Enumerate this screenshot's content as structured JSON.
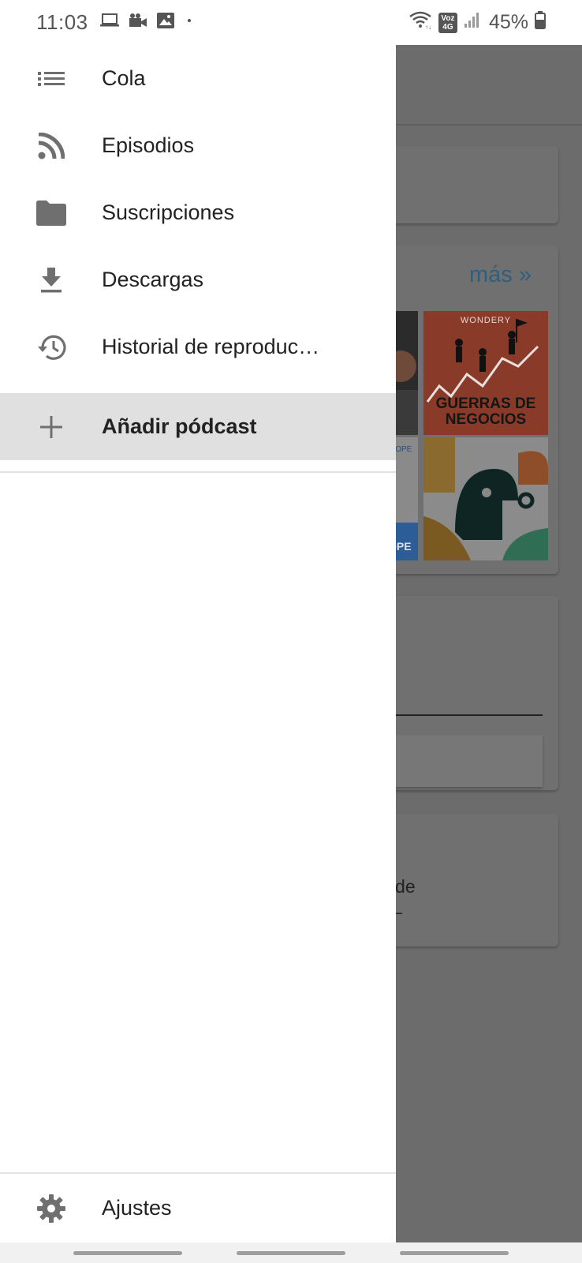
{
  "status_bar": {
    "time": "11:03",
    "battery_percent": "45%",
    "network_badge_top": "Voz",
    "network_badge_bottom": "4G",
    "left_icons": [
      "laptop-icon",
      "video-camera-icon",
      "image-icon",
      "dot-icon"
    ],
    "right_icons": [
      "wifi-icon",
      "network-badge-icon",
      "signal-icon",
      "battery-icon"
    ]
  },
  "drawer": {
    "items": [
      {
        "label": "Cola",
        "icon": "queue-list-icon"
      },
      {
        "label": "Episodios",
        "icon": "rss-feed-icon"
      },
      {
        "label": "Suscripciones",
        "icon": "folder-icon"
      },
      {
        "label": "Descargas",
        "icon": "download-icon"
      },
      {
        "label": "Historial de reproduc…",
        "icon": "history-icon"
      },
      {
        "label": "Añadir pódcast",
        "icon": "plus-icon",
        "active": true
      }
    ],
    "settings_label": "Ajustes",
    "settings_icon": "gear-icon"
  },
  "background": {
    "more_link": "más »",
    "podcast_cover_brand": "WONDERY",
    "podcast_cover_title": "GUERRAS DE NEGOCIOS",
    "cope_label_1": "COPE",
    "cope_label_2": "OPE",
    "partial_text_1": "r de",
    "partial_text_2": "–"
  },
  "colors": {
    "drawer_bg": "#ffffff",
    "active_item_bg": "#e0e0e0",
    "scrim": "#6b6b6b",
    "icon_gray": "#6f6f6f"
  }
}
